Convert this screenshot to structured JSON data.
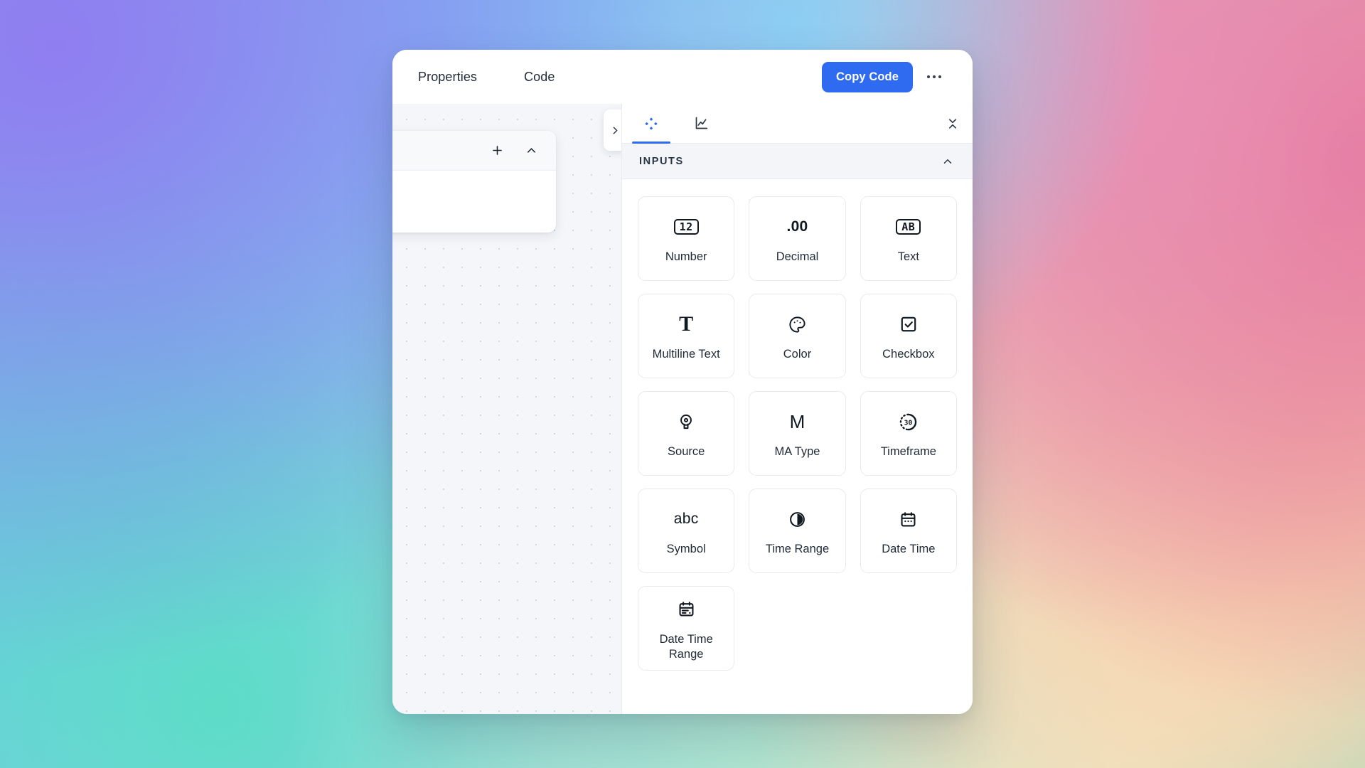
{
  "window": {
    "topbar": {
      "tabs": [
        {
          "label": "Properties",
          "name": "tab-properties"
        },
        {
          "label": "Code",
          "name": "tab-code"
        }
      ],
      "copy_code_label": "Copy Code",
      "more_icon": "more-horizontal-icon",
      "accent_color": "#2f6bf0"
    },
    "canvas": {
      "node_card": {
        "add_icon": "plus-icon",
        "collapse_icon": "chevron-up-icon"
      },
      "expand_panel_icon": "chevron-right-icon"
    },
    "right_panel": {
      "tabs": [
        {
          "icon": "diamond-cluster-icon",
          "name": "panel-tab-inputs",
          "active": true
        },
        {
          "icon": "line-chart-icon",
          "name": "panel-tab-plots",
          "active": false
        }
      ],
      "collapse_all_icon": "collapse-vertical-icon",
      "section": {
        "title": "INPUTS",
        "toggle_icon": "chevron-up-icon",
        "cards": [
          {
            "label": "Number",
            "icon": "number-12-box-icon",
            "glyph": "12",
            "glyph_style": "box-mono"
          },
          {
            "label": "Decimal",
            "icon": "decimal-point-icon",
            "glyph": ".00",
            "glyph_style": "plain-bold"
          },
          {
            "label": "Text",
            "icon": "text-ab-box-icon",
            "glyph": "AB",
            "glyph_style": "box-mono"
          },
          {
            "label": "Multiline Text",
            "icon": "multiline-text-t-icon",
            "glyph": "T",
            "glyph_style": "serif-t"
          },
          {
            "label": "Color",
            "icon": "palette-icon",
            "glyph": "",
            "glyph_style": "svg"
          },
          {
            "label": "Checkbox",
            "icon": "checkbox-checked-icon",
            "glyph": "",
            "glyph_style": "svg"
          },
          {
            "label": "Source",
            "icon": "map-pin-icon",
            "glyph": "",
            "glyph_style": "svg"
          },
          {
            "label": "MA Type",
            "icon": "letter-m-icon",
            "glyph": "M",
            "glyph_style": "letter-m"
          },
          {
            "label": "Timeframe",
            "icon": "timer-30-icon",
            "glyph": "",
            "glyph_style": "svg"
          },
          {
            "label": "Symbol",
            "icon": "abc-icon",
            "glyph": "abc",
            "glyph_style": "abc"
          },
          {
            "label": "Time Range",
            "icon": "clock-half-icon",
            "glyph": "",
            "glyph_style": "svg"
          },
          {
            "label": "Date Time",
            "icon": "calendar-icon",
            "glyph": "",
            "glyph_style": "svg"
          },
          {
            "label": "Date Time Range",
            "icon": "calendar-range-icon",
            "glyph": "",
            "glyph_style": "svg"
          }
        ]
      }
    }
  }
}
